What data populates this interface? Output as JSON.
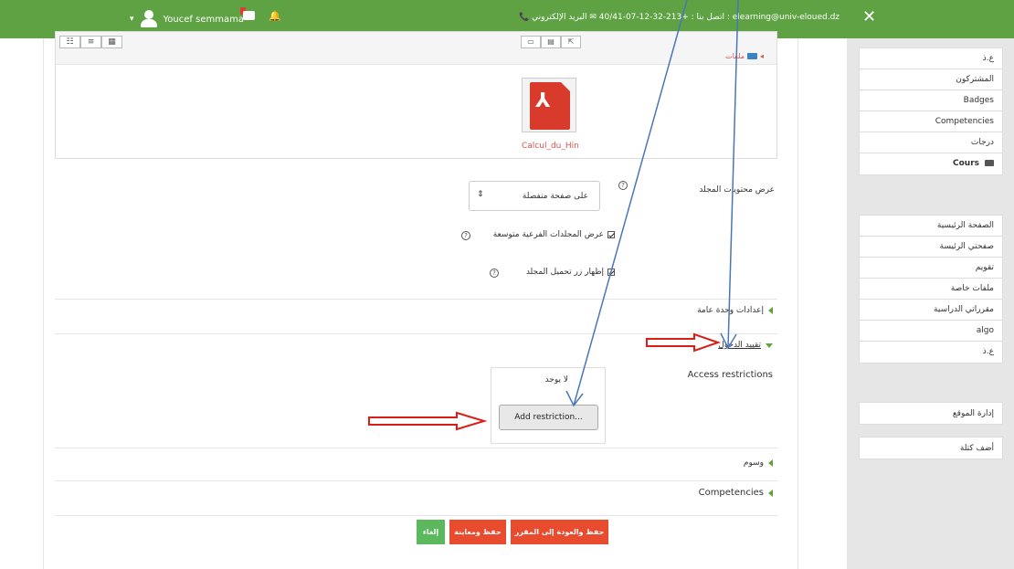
{
  "topbar": {
    "username": "Youcef semmama",
    "caret": "▾",
    "contact": "📞 اتصل بنا : +213-32-12-07-40/41 ✉ البريد الإلكتروني : elearning@univ-eloued.dz",
    "close": "✕"
  },
  "filepicker": {
    "view_buttons": [
      "☷",
      "≡",
      "▦"
    ],
    "action_buttons": [
      "▭",
      "▤",
      "⇱"
    ],
    "breadcrumb": "ملفات",
    "file_name": "Calcul_du_Hin"
  },
  "form": {
    "display_label": "عرض محتويات المجلد",
    "display_value": "على صفحة منفصلة",
    "select_arrow": "⇕",
    "expand_subfolders": "عرض المجلدات الفرعية متوسعة",
    "show_download": "إظهار زر تحميل المجلد",
    "help_glyph": "?",
    "section_common": "إعدادات وحدة عامة",
    "section_restrict": "تقييد الدخول",
    "access_restrictions": "Access restrictions",
    "none": "لا يوجد",
    "add_restriction": "Add restriction...",
    "section_tags": "وسوم",
    "section_competencies": "Competencies",
    "btn_save_return": "حفظ والعودة إلى المقرر",
    "btn_save_display": "حفظ ومعاينة",
    "btn_cancel": "إلغاء"
  },
  "sidebar": {
    "block1": [
      {
        "label": "ع.ذ",
        "bold": false
      },
      {
        "label": "المشتركون",
        "bold": false
      },
      {
        "label": "Badges",
        "bold": false
      },
      {
        "label": "Competencies",
        "bold": false
      },
      {
        "label": "درجات",
        "bold": false
      },
      {
        "label": "Cours",
        "bold": true
      }
    ],
    "block2": [
      {
        "label": "الصفحة الرئيسية"
      },
      {
        "label": "صفحتي الرئيسة"
      },
      {
        "label": "تقويم"
      },
      {
        "label": "ملفات خاصة"
      },
      {
        "label": "مقرراتي الدراسية"
      },
      {
        "label": "algo"
      },
      {
        "label": "ع.ذ"
      }
    ],
    "site_admin": "إدارة الموقع",
    "add_block": "أضف كتلة"
  },
  "colors": {
    "brand_green": "#5ea243",
    "button_red": "#e94b2f",
    "button_green": "#5cb85c",
    "arrow_red": "#d91e18",
    "arrow_blue": "#4a76b8"
  }
}
